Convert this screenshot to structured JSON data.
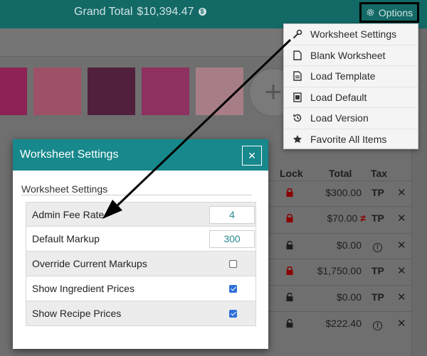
{
  "header": {
    "grand_total_label": "Grand Total",
    "grand_total_value": "$10,394.47",
    "info_glyph": "$",
    "options_label": "Options"
  },
  "colors": {
    "accent": "#136966",
    "modal_header": "#17888c",
    "lock_red": "#8b0000",
    "swatches": [
      "#9c2560",
      "#a8566d",
      "#5a1f42",
      "#9a3366",
      "#b5858e"
    ]
  },
  "options_menu": {
    "items": [
      {
        "label": "Worksheet Settings",
        "icon": "wrench-icon"
      },
      {
        "label": "Blank Worksheet",
        "icon": "blank-file-icon"
      },
      {
        "label": "Load Template",
        "icon": "template-file-icon"
      },
      {
        "label": "Load Default",
        "icon": "default-file-icon"
      },
      {
        "label": "Load Version",
        "icon": "history-icon"
      },
      {
        "label": "Favorite All Items",
        "icon": "star-icon"
      }
    ]
  },
  "table": {
    "headers": {
      "lock": "Lock",
      "total": "Total",
      "tax": "Tax"
    },
    "rows": [
      {
        "lock": "locked",
        "total": "$300.00",
        "tax": "TP",
        "delete": "✕"
      },
      {
        "lock": "locked",
        "total": "$70.00",
        "modified": "≠",
        "tax": "TP",
        "delete": "✕"
      },
      {
        "lock": "unlocked",
        "total": "$0.00",
        "tax": "!",
        "delete": "✕"
      },
      {
        "lock": "locked",
        "total": "$1,750.00",
        "tax": "TP",
        "delete": "✕"
      },
      {
        "lock": "unlocked",
        "total": "$0.00",
        "tax": "TP",
        "delete": "✕"
      },
      {
        "lock": "unlocked",
        "total": "$222.40",
        "tax": "!",
        "delete": "✕"
      }
    ]
  },
  "modal": {
    "title": "Worksheet Settings",
    "close_glyph": "✕",
    "section_title": "Worksheet Settings",
    "settings": [
      {
        "label": "Admin Fee Rate",
        "value": "4"
      },
      {
        "label": "Default Markup",
        "value": "300"
      },
      {
        "label": "Override Current Markups",
        "checked": false
      },
      {
        "label": "Show Ingredient Prices",
        "checked": true
      },
      {
        "label": "Show Recipe Prices",
        "checked": true
      }
    ]
  },
  "add_button_label": "+"
}
